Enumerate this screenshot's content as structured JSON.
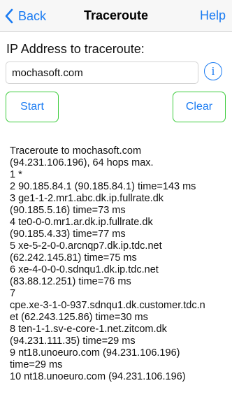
{
  "nav": {
    "back_label": "Back",
    "title": "Traceroute",
    "help_label": "Help"
  },
  "form": {
    "ip_label": "IP Address to traceroute:",
    "ip_value": "mochasoft.com",
    "info_icon": "info-circle-icon",
    "start_label": "Start",
    "clear_label": "Clear"
  },
  "output": {
    "lines": [
      "Traceroute to mochasoft.com",
      "(94.231.106.196), 64 hops max.",
      "1 *",
      "2 90.185.84.1 (90.185.84.1) time=143 ms",
      "3 ge1-1-2.mr1.abc.dk.ip.fullrate.dk",
      "(90.185.5.16) time=73 ms",
      "4 te0-0-0.mr1.ar.dk.ip.fullrate.dk",
      "(90.185.4.33) time=77 ms",
      "5 xe-5-2-0-0.arcnqp7.dk.ip.tdc.net",
      "(62.242.145.81) time=75 ms",
      "6 xe-4-0-0-0.sdnqu1.dk.ip.tdc.net",
      "(83.88.12.251) time=76 ms",
      "7",
      "cpe.xe-3-1-0-937.sdnqu1.dk.customer.tdc.n",
      "et (62.243.125.86) time=30 ms",
      "8 ten-1-1.sv-e-core-1.net.zitcom.dk",
      "(94.231.111.35) time=29 ms",
      "9 nt18.unoeuro.com (94.231.106.196)",
      "time=29 ms",
      "10 nt18.unoeuro.com (94.231.106.196)"
    ]
  },
  "colors": {
    "accent": "#1a7bf2",
    "button_border": "#3dcc3d",
    "nav_background": "#f7f7f7"
  }
}
